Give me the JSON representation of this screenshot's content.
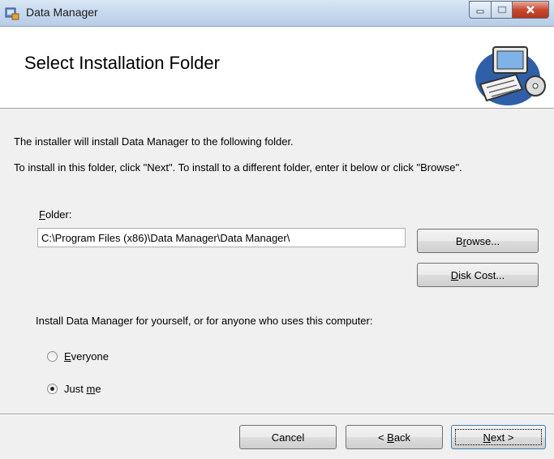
{
  "window": {
    "title": "Data Manager"
  },
  "header": {
    "title": "Select Installation Folder"
  },
  "body": {
    "line1": "The installer will install Data Manager to the following folder.",
    "line2": "To install in this folder, click \"Next\". To install to a different folder, enter it below or click \"Browse\"."
  },
  "folder": {
    "label_mnemonic": "F",
    "label_rest": "older:",
    "value": "C:\\Program Files (x86)\\Data Manager\\Data Manager\\"
  },
  "buttons": {
    "browse_pre": "B",
    "browse_mnemonic": "r",
    "browse_post": "owse...",
    "diskcost_mnemonic": "D",
    "diskcost_post": "isk Cost...",
    "cancel": "Cancel",
    "back_pre": "< ",
    "back_mnemonic": "B",
    "back_post": "ack",
    "next_mnemonic": "N",
    "next_post": "ext >"
  },
  "install_for": {
    "prompt": "Install Data Manager for yourself, or for anyone who uses this computer:",
    "everyone_mnemonic": "E",
    "everyone_post": "veryone",
    "justme_pre": "Just ",
    "justme_mnemonic": "m",
    "justme_post": "e",
    "selected": "Just me"
  },
  "colors": {
    "title_bar": "#c3d6ec",
    "close_button": "#c64a30",
    "background": "#f0f0f0"
  },
  "icons": [
    "installer-app-icon",
    "minimize-icon",
    "maximize-icon",
    "close-icon",
    "computer-cd-icon"
  ]
}
